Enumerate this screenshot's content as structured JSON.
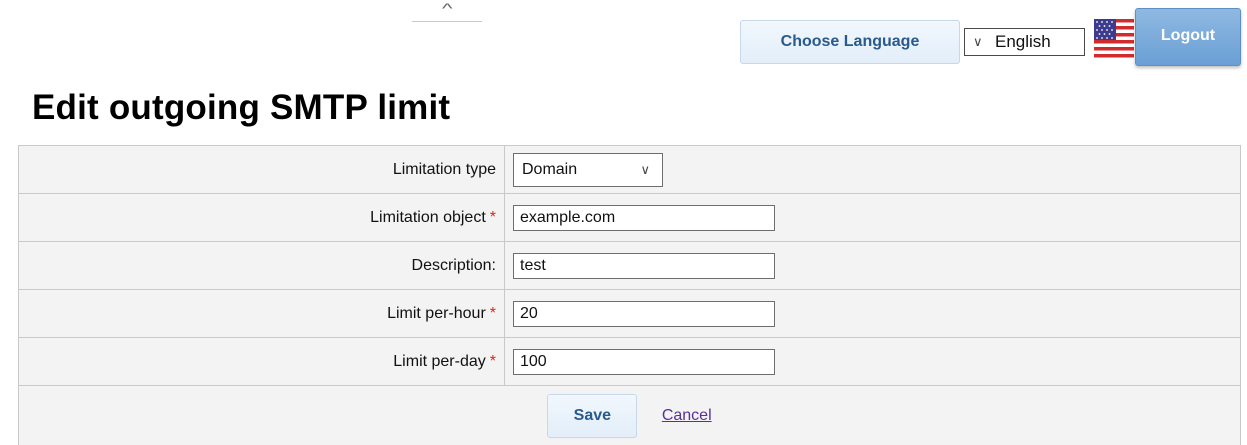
{
  "collapse": {
    "glyph": "^"
  },
  "language": {
    "choose_label": "Choose Language",
    "selected": "English",
    "chevron": "∨",
    "flag_icon": "us-flag-icon"
  },
  "header": {
    "logout_label": "Logout"
  },
  "page": {
    "title": "Edit outgoing SMTP limit"
  },
  "form": {
    "limitation_type": {
      "label": "Limitation type",
      "value": "Domain",
      "chevron": "∨"
    },
    "limitation_object": {
      "label": "Limitation object",
      "required": "*",
      "value": "example.com"
    },
    "description": {
      "label": "Description:",
      "value": "test"
    },
    "limit_per_hour": {
      "label": "Limit per-hour",
      "required": "*",
      "value": "20"
    },
    "limit_per_day": {
      "label": "Limit per-day",
      "required": "*",
      "value": "100"
    },
    "save_label": "Save",
    "cancel_label": "Cancel"
  },
  "colors": {
    "accent_blue": "#2a5a8c",
    "logout_bg": "#7aabdb",
    "required_red": "#e0221c",
    "link_purple": "#5a2f9a"
  }
}
